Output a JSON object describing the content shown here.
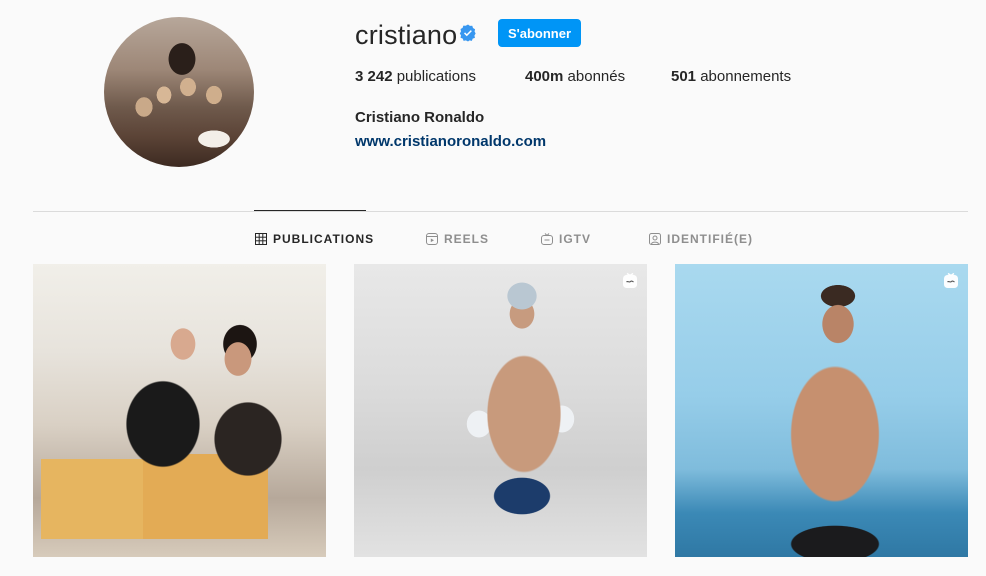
{
  "profile": {
    "username": "cristiano",
    "verified_icon": "verified-badge-icon",
    "follow_label": "S'abonner",
    "full_name": "Cristiano Ronaldo",
    "website": "www.cristianoronaldo.com"
  },
  "stats": {
    "posts_count": "3 242",
    "posts_label": "publications",
    "followers_count": "400m",
    "followers_label": "abonnés",
    "following_count": "501",
    "following_label": "abonnements"
  },
  "tabs": [
    {
      "label": "PUBLICATIONS",
      "icon": "grid-icon",
      "active": true
    },
    {
      "label": "REELS",
      "icon": "reels-icon",
      "active": false
    },
    {
      "label": "IGTV",
      "icon": "igtv-icon",
      "active": false
    },
    {
      "label": "IDENTIFIÉ(E)",
      "icon": "tagged-icon",
      "active": false
    }
  ],
  "posts": [
    {
      "type": "photo"
    },
    {
      "type": "reel",
      "badge_icon": "reel-badge-icon"
    },
    {
      "type": "reel",
      "badge_icon": "reel-badge-icon"
    }
  ],
  "colors": {
    "accent": "#0095f6",
    "link": "#00376b",
    "verified": "#3897f0",
    "muted": "#8e8e8e",
    "text": "#262626",
    "background": "#fafafa"
  }
}
